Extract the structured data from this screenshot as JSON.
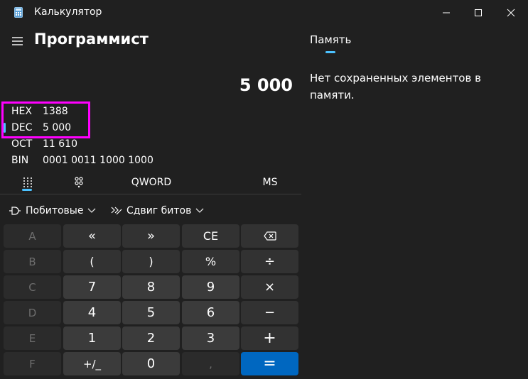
{
  "window": {
    "title": "Калькулятор"
  },
  "header": {
    "mode": "Программист",
    "memory_tab": "Память"
  },
  "memory": {
    "empty_text": "Нет сохраненных элементов в памяти."
  },
  "display": {
    "value": "5 000"
  },
  "radix": [
    {
      "name": "HEX",
      "value": "1388"
    },
    {
      "name": "DEC",
      "value": "5 000"
    },
    {
      "name": "OCT",
      "value": "11 610"
    },
    {
      "name": "BIN",
      "value": "0001 0011 1000 1000"
    }
  ],
  "tabs": {
    "word_size": "QWORD",
    "ms": "MS"
  },
  "dropdowns": {
    "bitwise": "Побитовые",
    "bitshift": "Сдвиг битов"
  },
  "keys": {
    "row1": [
      "A",
      "«",
      "»",
      "CE",
      "⌫"
    ],
    "row2": [
      "B",
      "(",
      ")",
      "%",
      "÷"
    ],
    "row3": [
      "C",
      "7",
      "8",
      "9",
      "×"
    ],
    "row4": [
      "D",
      "4",
      "5",
      "6",
      "−"
    ],
    "row5": [
      "E",
      "1",
      "2",
      "3",
      "+"
    ],
    "row6": [
      "F",
      "+/_",
      "0",
      ",",
      "="
    ]
  },
  "colors": {
    "accent": "#4cc2ff",
    "equals": "#0067c0",
    "highlight": "#ff00ff",
    "background": "#202020"
  }
}
